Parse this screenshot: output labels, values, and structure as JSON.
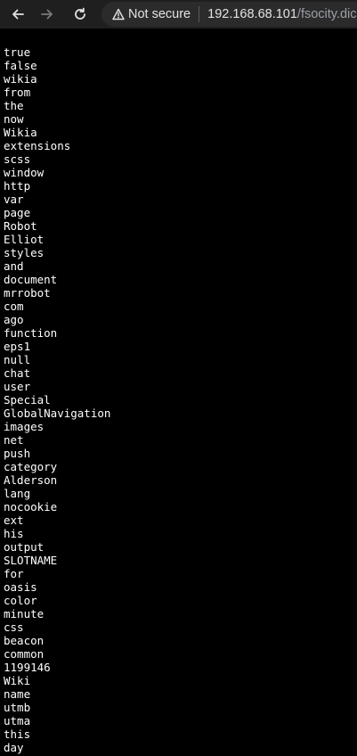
{
  "browser": {
    "security_label": "Not secure",
    "url_host": "192.168.68.101",
    "url_path": "/fsocity.dic",
    "icons": {
      "back": "arrow-left-icon",
      "forward": "arrow-right-icon",
      "reload": "reload-icon",
      "security": "warning-triangle-icon"
    }
  },
  "document": {
    "words": [
      "true",
      "false",
      "wikia",
      "from",
      "the",
      "now",
      "Wikia",
      "extensions",
      "scss",
      "window",
      "http",
      "var",
      "page",
      "Robot",
      "Elliot",
      "styles",
      "and",
      "document",
      "mrrobot",
      "com",
      "ago",
      "function",
      "eps1",
      "null",
      "chat",
      "user",
      "Special",
      "GlobalNavigation",
      "images",
      "net",
      "push",
      "category",
      "Alderson",
      "lang",
      "nocookie",
      "ext",
      "his",
      "output",
      "SLOTNAME",
      "for",
      "oasis",
      "color",
      "minute",
      "css",
      "beacon",
      "common",
      "1199146",
      "Wiki",
      "name",
      "utmb",
      "utma",
      "this",
      "day"
    ]
  },
  "colors": {
    "page_background": "#000000",
    "toolbar_background": "#1f1f1f",
    "omnibox_background": "#2b2b2b",
    "text": "#ffffff",
    "url_path": "#9aa0a6"
  }
}
